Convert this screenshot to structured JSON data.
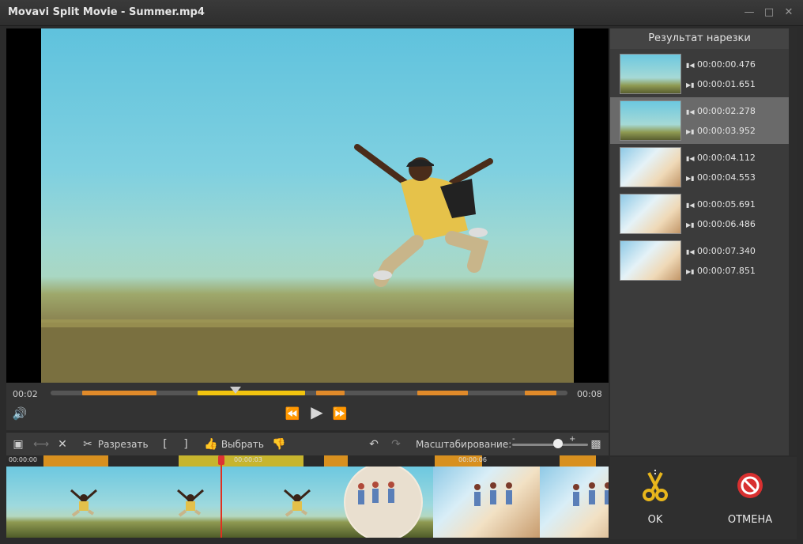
{
  "window": {
    "title": "Movavi Split Movie - Summer.mp4",
    "controls": [
      "minimize-icon",
      "maximize-icon",
      "close-icon"
    ]
  },
  "player": {
    "current_time": "00:02",
    "end_time": "00:08",
    "segments_color": "#e08a2a",
    "active_segment_color": "#f1c40f"
  },
  "toolbar": {
    "cut_label": "Разрезать",
    "select_label": "Выбрать",
    "zoom_label": "Масштабирование:",
    "zoom_minus": "-",
    "zoom_plus": "+"
  },
  "timeline": {
    "ruler_labels": [
      "00:00:00",
      "00:00:03",
      "00:00:06"
    ]
  },
  "results": {
    "title": "Результат нарезки",
    "clips": [
      {
        "start": "00:00:00.476",
        "end": "00:00:01.651",
        "thumb": "jumping-man",
        "selected": false
      },
      {
        "start": "00:00:02.278",
        "end": "00:00:03.952",
        "thumb": "jumping-man",
        "selected": true
      },
      {
        "start": "00:00:04.112",
        "end": "00:00:04.553",
        "thumb": "beach-jump",
        "selected": false
      },
      {
        "start": "00:00:05.691",
        "end": "00:00:06.486",
        "thumb": "beach-jump",
        "selected": false
      },
      {
        "start": "00:00:07.340",
        "end": "00:00:07.851",
        "thumb": "beach-jump",
        "selected": false
      }
    ]
  },
  "actions": {
    "ok_label": "OK",
    "cancel_label": "ОТМЕНА"
  }
}
